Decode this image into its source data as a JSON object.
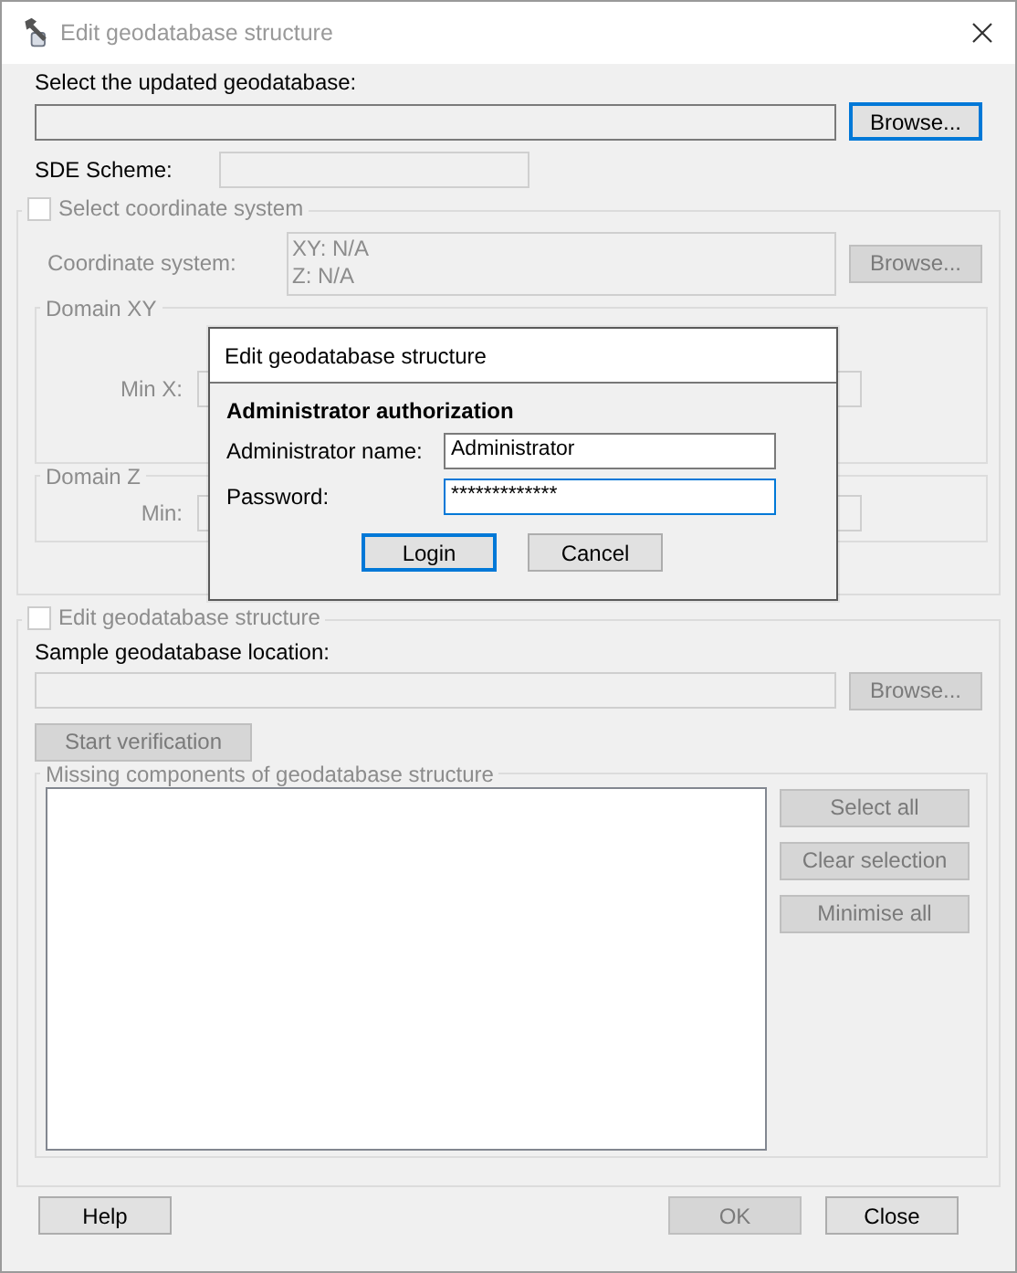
{
  "window": {
    "title": "Edit geodatabase structure"
  },
  "geodatabase": {
    "label": "Select the updated geodatabase:",
    "browse": {
      "label": "Browse...",
      "disabled": false,
      "focused": true
    }
  },
  "sde_scheme": {
    "label": "SDE Scheme:"
  },
  "coordinate_group": {
    "label": "Select coordinate system",
    "checked": false,
    "disabled": true,
    "coordinate_system_label": "Coordinate system:",
    "coordinate_system_value": [
      "XY: N/A",
      "Z: N/A"
    ],
    "browse": {
      "label": "Browse...",
      "disabled": true,
      "focused": false
    },
    "domain_xy": {
      "label": "Domain XY",
      "min_x_label": "Min X:"
    },
    "domain_z": {
      "label": "Domain Z",
      "min_label": "Min:"
    }
  },
  "structure_group": {
    "label": "Edit geodatabase structure",
    "checked": false,
    "disabled": true,
    "location_label": "Sample geodatabase location:",
    "browse": {
      "label": "Browse...",
      "disabled": true,
      "focused": false
    },
    "start_button": {
      "label": "Start verification",
      "disabled": true,
      "focused": false
    },
    "missing": {
      "label": "Missing components of geodatabase structure",
      "buttons": [
        {
          "label": "Select all",
          "disabled": true,
          "focused": false
        },
        {
          "label": "Clear selection",
          "disabled": true,
          "focused": false
        },
        {
          "label": "Minimise all",
          "disabled": true,
          "focused": false
        }
      ]
    }
  },
  "buttons": [
    {
      "label": "Help",
      "disabled": false,
      "focused": false
    },
    {
      "label": "OK",
      "disabled": true,
      "focused": false
    },
    {
      "label": "Close",
      "disabled": false,
      "focused": false
    }
  ],
  "login_dialog": {
    "title": "Edit geodatabase structure",
    "heading": "Administrator authorization",
    "fields": [
      {
        "label": "Administrator name:",
        "value": "Administrator",
        "focused": false
      },
      {
        "label": "Password:",
        "value": "*************",
        "focused": true
      }
    ],
    "buttons": [
      {
        "label": "Login",
        "disabled": false,
        "focused": true
      },
      {
        "label": "Cancel",
        "disabled": false,
        "focused": false
      }
    ]
  }
}
